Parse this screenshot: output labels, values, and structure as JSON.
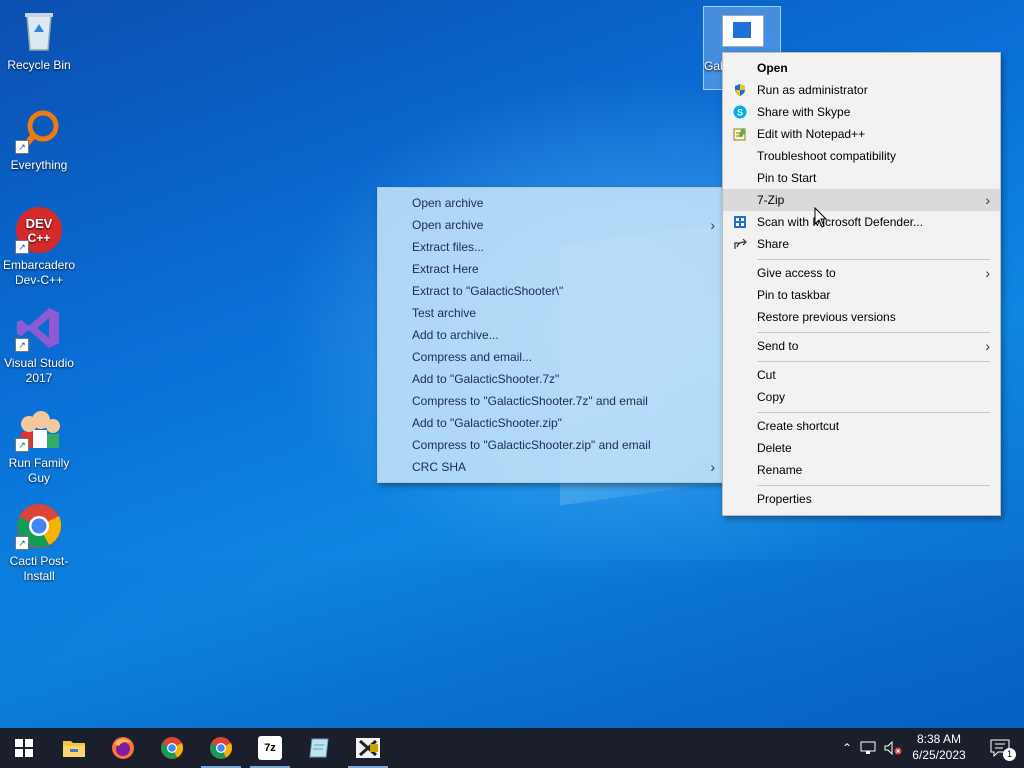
{
  "desktop": {
    "icons": [
      {
        "label": "Recycle Bin",
        "icon": "recycle-bin-icon"
      },
      {
        "label": "Everything",
        "icon": "magnifier-icon"
      },
      {
        "label": "Embarcadero Dev-C++",
        "icon": "devcpp-icon",
        "badge": "DEV C++"
      },
      {
        "label": "Visual Studio 2017",
        "icon": "visual-studio-icon"
      },
      {
        "label": "Run Family Guy",
        "icon": "family-guy-icon"
      },
      {
        "label": "Cacti Post-Install",
        "icon": "chrome-icon"
      }
    ],
    "selected_icon_label": "Gal"
  },
  "context_menu": {
    "items": [
      {
        "label": "Open",
        "bold": true
      },
      {
        "label": "Run as administrator",
        "icon": "shield-icon"
      },
      {
        "label": "Share with Skype",
        "icon": "skype-icon"
      },
      {
        "label": "Edit with Notepad++",
        "icon": "notepad-icon"
      },
      {
        "label": "Troubleshoot compatibility"
      },
      {
        "label": "Pin to Start"
      },
      {
        "label": "7-Zip",
        "submenu": true,
        "highlighted": true
      },
      {
        "label": "Scan with Microsoft Defender...",
        "icon": "defender-icon"
      },
      {
        "label": "Share",
        "icon": "share-icon"
      },
      {
        "label": "Give access to",
        "submenu": true
      },
      {
        "label": "Pin to taskbar"
      },
      {
        "label": "Restore previous versions"
      },
      {
        "label": "Send to",
        "submenu": true
      },
      {
        "label": "Cut"
      },
      {
        "label": "Copy"
      },
      {
        "label": "Create shortcut"
      },
      {
        "label": "Delete"
      },
      {
        "label": "Rename"
      },
      {
        "label": "Properties"
      }
    ]
  },
  "sevenzip_submenu": {
    "items": [
      {
        "label": "Open archive"
      },
      {
        "label": "Open archive",
        "submenu": true
      },
      {
        "label": "Extract files..."
      },
      {
        "label": "Extract Here"
      },
      {
        "label": "Extract to \"GalacticShooter\\\""
      },
      {
        "label": "Test archive"
      },
      {
        "label": "Add to archive..."
      },
      {
        "label": "Compress and email..."
      },
      {
        "label": "Add to \"GalacticShooter.7z\""
      },
      {
        "label": "Compress to \"GalacticShooter.7z\" and email"
      },
      {
        "label": "Add to \"GalacticShooter.zip\""
      },
      {
        "label": "Compress to \"GalacticShooter.zip\" and email"
      },
      {
        "label": "CRC SHA",
        "submenu": true
      }
    ]
  },
  "taskbar": {
    "apps": [
      {
        "name": "windows-start-icon"
      },
      {
        "name": "file-explorer-icon"
      },
      {
        "name": "firefox-icon"
      },
      {
        "name": "chrome-icon"
      },
      {
        "name": "chrome-icon-2",
        "active": true
      },
      {
        "name": "7zip-icon",
        "text": "7z",
        "active": true
      },
      {
        "name": "notepad-icon"
      },
      {
        "name": "xampp-icon",
        "active": true
      }
    ],
    "clock": {
      "time": "8:38 AM",
      "date": "6/25/2023"
    },
    "notification_count": "1"
  },
  "colors": {
    "desktop": "#0a6fd6",
    "menu_bg": "#f2f2f2",
    "submenu_bg": "#c4e2f8",
    "highlight": "#dadada",
    "taskbar": "#1b1f2b"
  }
}
